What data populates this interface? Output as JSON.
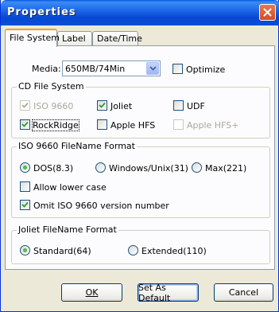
{
  "window": {
    "title": "Properties"
  },
  "tabs": [
    {
      "label": "File System",
      "active": true
    },
    {
      "label": "Label",
      "active": false
    },
    {
      "label": "Date/Time",
      "active": false
    }
  ],
  "media": {
    "label": "Media:",
    "value": "650MB/74Min",
    "optimize_label": "Optimize",
    "optimize_checked": false
  },
  "cd_file_system": {
    "title": "CD File System",
    "options": [
      {
        "label": "ISO 9660",
        "checked": true,
        "enabled": false
      },
      {
        "label": "Joliet",
        "checked": true,
        "enabled": true
      },
      {
        "label": "UDF",
        "checked": false,
        "enabled": true
      },
      {
        "label": "RockRidge",
        "checked": true,
        "enabled": true
      },
      {
        "label": "Apple HFS",
        "checked": false,
        "enabled": true
      },
      {
        "label": "Apple HFS+",
        "checked": false,
        "enabled": false
      }
    ]
  },
  "iso_format": {
    "title": "ISO 9660 FileName Format",
    "radios": [
      {
        "label": "DOS(8.3)",
        "selected": true
      },
      {
        "label": "Windows/Unix(31)",
        "selected": false
      },
      {
        "label": "Max(221)",
        "selected": false
      }
    ],
    "allow_lower_label": "Allow lower case",
    "allow_lower_checked": false,
    "omit_version_label": "Omit ISO 9660 version number",
    "omit_version_checked": true
  },
  "joliet_format": {
    "title": "Joliet FileName Format",
    "radios": [
      {
        "label": "Standard(64)",
        "selected": true
      },
      {
        "label": "Extended(110)",
        "selected": false
      }
    ]
  },
  "buttons": {
    "ok": "OK",
    "set_default": "Set As Default",
    "cancel": "Cancel"
  },
  "colors": {
    "titlebar": "#0a58e3",
    "accent_tab": "#f3a11d",
    "check": "#21a121"
  },
  "icons": {
    "close": "close-icon",
    "dropdown": "chevron-down-icon",
    "check": "check-icon"
  }
}
